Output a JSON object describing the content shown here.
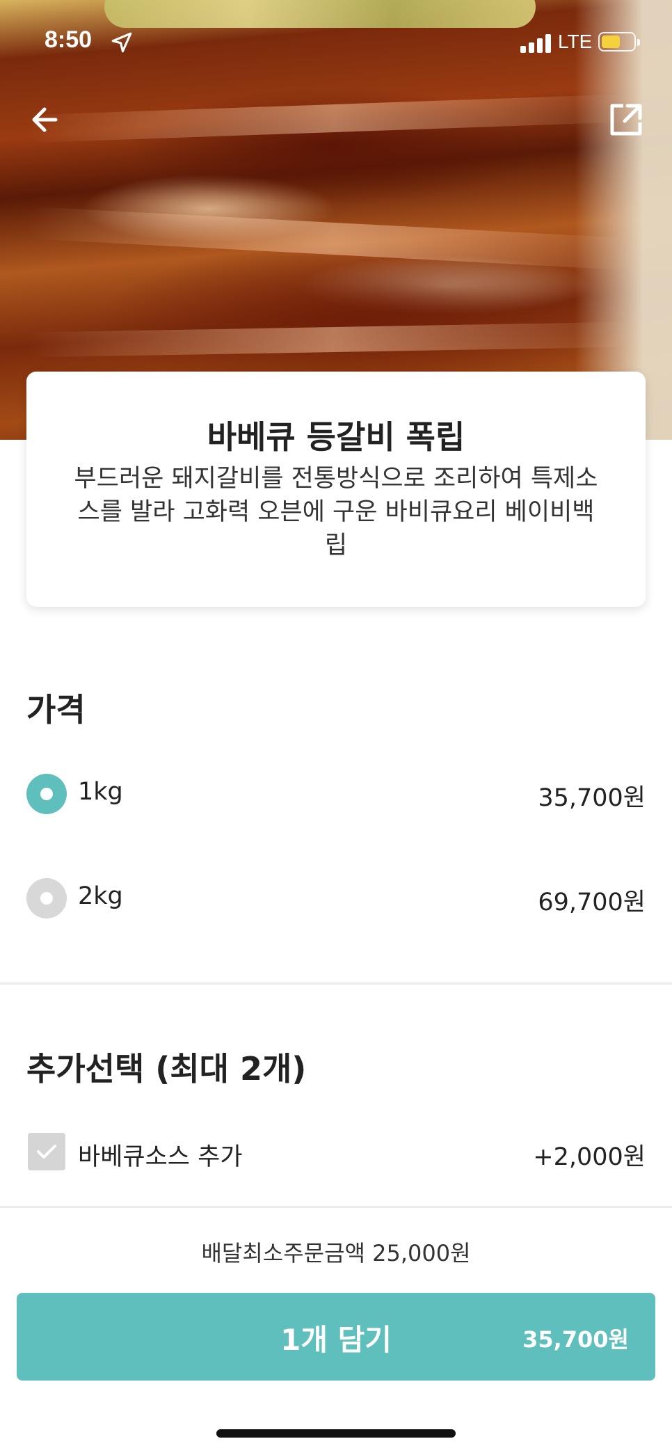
{
  "status_bar": {
    "time": "8:50",
    "network": "LTE"
  },
  "hero": {
    "image": "barbecue-pork-ribs-photo"
  },
  "menu": {
    "title": "바베큐 등갈비 폭립",
    "description": "부드러운 돼지갈비를 전통방식으로 조리하여 특제소스를 발라 고화력 오븐에 구운 바비큐요리 베이비백립"
  },
  "price_section": {
    "title": "가격",
    "options": [
      {
        "label": "1kg",
        "price": "35,700원",
        "selected": true
      },
      {
        "label": "2kg",
        "price": "69,700원",
        "selected": false
      }
    ]
  },
  "extra_section": {
    "title": "추가선택 (최대 2개)",
    "options": [
      {
        "label": "바베큐소스 추가",
        "price": "+2,000원",
        "checked": false
      }
    ]
  },
  "footer": {
    "min_order": "배달최소주문금액 25,000원",
    "cart_button_label": "1개 담기",
    "cart_total": "35,700원"
  },
  "colors": {
    "accent": "#5fbfbd",
    "inactive": "#d8d8d8",
    "battery": "#f5d23c"
  }
}
